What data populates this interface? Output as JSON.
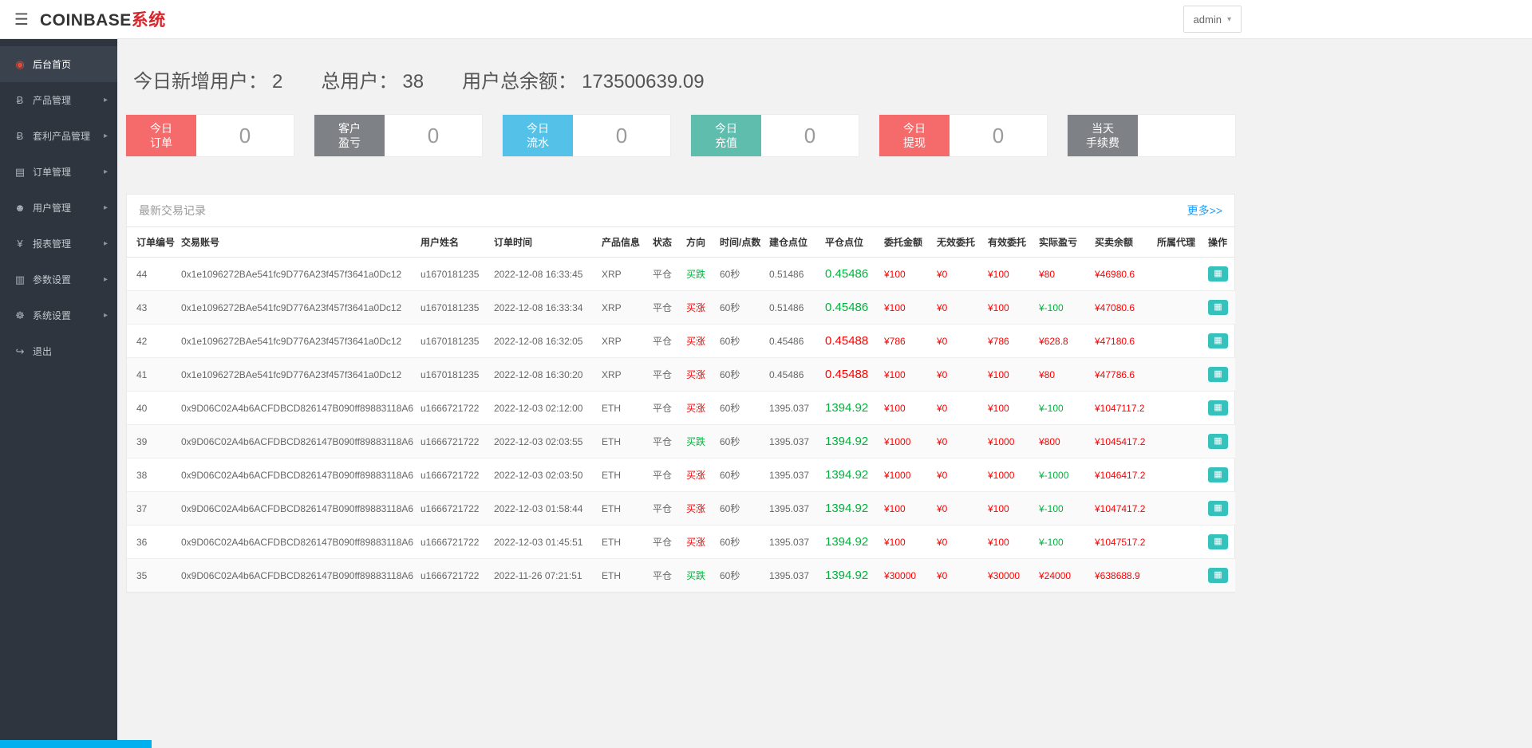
{
  "icons": {
    "menu": "☰",
    "caret_down": "▾",
    "chevron_right": "▸",
    "table_glyph": "▦"
  },
  "colors": {
    "accent_red": "#f56a6a",
    "gray": "#7e8287",
    "blue": "#54c2e8",
    "teal": "#5fbdae",
    "text_red": "#ff0000",
    "text_green": "#00b33c",
    "op_button": "#35c2bd",
    "sidebar_bg": "#2f353e",
    "link_blue": "#1e9fff",
    "scrollbar_thumb": "#00b0ef"
  },
  "topbar": {
    "brand_main": "COINBASE",
    "brand_accent": "系统",
    "user_menu_label": "admin"
  },
  "sidebar": {
    "items": [
      {
        "id": "dashboard",
        "label": "后台首页",
        "glyph": "◉",
        "icon": "dashboard",
        "active": true,
        "expandable": false
      },
      {
        "id": "products",
        "label": "产品管理",
        "glyph": "Ƀ",
        "icon": "bitcoin",
        "active": false,
        "expandable": true
      },
      {
        "id": "arbitrage-products",
        "label": "套利产品管理",
        "glyph": "Ƀ",
        "icon": "bitcoin",
        "active": false,
        "expandable": true
      },
      {
        "id": "orders",
        "label": "订单管理",
        "glyph": "▤",
        "icon": "document",
        "active": false,
        "expandable": true
      },
      {
        "id": "users",
        "label": "用户管理",
        "glyph": "☻",
        "icon": "user",
        "active": false,
        "expandable": true
      },
      {
        "id": "reports",
        "label": "报表管理",
        "glyph": "¥",
        "icon": "yen",
        "active": false,
        "expandable": true
      },
      {
        "id": "parameters",
        "label": "参数设置",
        "glyph": "▥",
        "icon": "document",
        "active": false,
        "expandable": true
      },
      {
        "id": "system",
        "label": "系统设置",
        "glyph": "☸",
        "icon": "gears",
        "active": false,
        "expandable": true
      },
      {
        "id": "logout",
        "label": "退出",
        "glyph": "↪",
        "icon": "logout",
        "active": false,
        "expandable": false
      }
    ]
  },
  "stats_summary": [
    {
      "label": "今日新增用户：",
      "value": "2"
    },
    {
      "label": "总用户：",
      "value": "38"
    },
    {
      "label": "用户总余额：",
      "value": "173500639.09"
    }
  ],
  "stat_cards": [
    {
      "id": "today-orders",
      "line1": "今日",
      "line2": "订单",
      "value": "0",
      "color": "#f56a6a"
    },
    {
      "id": "customer-pnl",
      "line1": "客户",
      "line2": "盈亏",
      "value": "0",
      "color": "#7e8287"
    },
    {
      "id": "today-flow",
      "line1": "今日",
      "line2": "流水",
      "value": "0",
      "color": "#54c2e8"
    },
    {
      "id": "today-deposit",
      "line1": "今日",
      "line2": "充值",
      "value": "0",
      "color": "#5fbdae"
    },
    {
      "id": "today-withdraw",
      "line1": "今日",
      "line2": "提现",
      "value": "0",
      "color": "#f56a6a"
    },
    {
      "id": "today-fees",
      "line1": "当天",
      "line2": "手续费",
      "value": "",
      "color": "#7e8287"
    }
  ],
  "panel": {
    "title": "最新交易记录",
    "more_link": "更多>>"
  },
  "table": {
    "headers": [
      "订单编号",
      "交易账号",
      "用户姓名",
      "订单时间",
      "产品信息",
      "状态",
      "方向",
      "时间/点数",
      "建仓点位",
      "平仓点位",
      "委托金额",
      "无效委托",
      "有效委托",
      "实际盈亏",
      "买卖余额",
      "所属代理",
      "操作"
    ],
    "rows": [
      {
        "id": "44",
        "account": "0x1e1096272BAe541fc9D776A23f457f3641a0Dc12",
        "username": "u1670181235",
        "time": "2022-12-08 16:33:45",
        "product": "XRP",
        "status": "平仓",
        "direction": "买跌",
        "direction_color": "green",
        "duration": "60秒",
        "open_price": "0.51486",
        "close_price": "0.45486",
        "close_color": "green",
        "amount": "¥100",
        "invalid": "¥0",
        "valid": "¥100",
        "profit": "¥80",
        "profit_color": "red",
        "balance": "¥46980.6",
        "agent": ""
      },
      {
        "id": "43",
        "account": "0x1e1096272BAe541fc9D776A23f457f3641a0Dc12",
        "username": "u1670181235",
        "time": "2022-12-08 16:33:34",
        "product": "XRP",
        "status": "平仓",
        "direction": "买涨",
        "direction_color": "red",
        "duration": "60秒",
        "open_price": "0.51486",
        "close_price": "0.45486",
        "close_color": "green",
        "amount": "¥100",
        "invalid": "¥0",
        "valid": "¥100",
        "profit": "¥-100",
        "profit_color": "green",
        "balance": "¥47080.6",
        "agent": ""
      },
      {
        "id": "42",
        "account": "0x1e1096272BAe541fc9D776A23f457f3641a0Dc12",
        "username": "u1670181235",
        "time": "2022-12-08 16:32:05",
        "product": "XRP",
        "status": "平仓",
        "direction": "买涨",
        "direction_color": "red",
        "duration": "60秒",
        "open_price": "0.45486",
        "close_price": "0.45488",
        "close_color": "red",
        "amount": "¥786",
        "invalid": "¥0",
        "valid": "¥786",
        "profit": "¥628.8",
        "profit_color": "red",
        "balance": "¥47180.6",
        "agent": ""
      },
      {
        "id": "41",
        "account": "0x1e1096272BAe541fc9D776A23f457f3641a0Dc12",
        "username": "u1670181235",
        "time": "2022-12-08 16:30:20",
        "product": "XRP",
        "status": "平仓",
        "direction": "买涨",
        "direction_color": "red",
        "duration": "60秒",
        "open_price": "0.45486",
        "close_price": "0.45488",
        "close_color": "red",
        "amount": "¥100",
        "invalid": "¥0",
        "valid": "¥100",
        "profit": "¥80",
        "profit_color": "red",
        "balance": "¥47786.6",
        "agent": ""
      },
      {
        "id": "40",
        "account": "0x9D06C02A4b6ACFDBCD826147B090ff89883118A6",
        "username": "u1666721722",
        "time": "2022-12-03 02:12:00",
        "product": "ETH",
        "status": "平仓",
        "direction": "买涨",
        "direction_color": "red",
        "duration": "60秒",
        "open_price": "1395.037",
        "close_price": "1394.92",
        "close_color": "green",
        "amount": "¥100",
        "invalid": "¥0",
        "valid": "¥100",
        "profit": "¥-100",
        "profit_color": "green",
        "balance": "¥1047117.2",
        "agent": ""
      },
      {
        "id": "39",
        "account": "0x9D06C02A4b6ACFDBCD826147B090ff89883118A6",
        "username": "u1666721722",
        "time": "2022-12-03 02:03:55",
        "product": "ETH",
        "status": "平仓",
        "direction": "买跌",
        "direction_color": "green",
        "duration": "60秒",
        "open_price": "1395.037",
        "close_price": "1394.92",
        "close_color": "green",
        "amount": "¥1000",
        "invalid": "¥0",
        "valid": "¥1000",
        "profit": "¥800",
        "profit_color": "red",
        "balance": "¥1045417.2",
        "agent": ""
      },
      {
        "id": "38",
        "account": "0x9D06C02A4b6ACFDBCD826147B090ff89883118A6",
        "username": "u1666721722",
        "time": "2022-12-03 02:03:50",
        "product": "ETH",
        "status": "平仓",
        "direction": "买涨",
        "direction_color": "red",
        "duration": "60秒",
        "open_price": "1395.037",
        "close_price": "1394.92",
        "close_color": "green",
        "amount": "¥1000",
        "invalid": "¥0",
        "valid": "¥1000",
        "profit": "¥-1000",
        "profit_color": "green",
        "balance": "¥1046417.2",
        "agent": ""
      },
      {
        "id": "37",
        "account": "0x9D06C02A4b6ACFDBCD826147B090ff89883118A6",
        "username": "u1666721722",
        "time": "2022-12-03 01:58:44",
        "product": "ETH",
        "status": "平仓",
        "direction": "买涨",
        "direction_color": "red",
        "duration": "60秒",
        "open_price": "1395.037",
        "close_price": "1394.92",
        "close_color": "green",
        "amount": "¥100",
        "invalid": "¥0",
        "valid": "¥100",
        "profit": "¥-100",
        "profit_color": "green",
        "balance": "¥1047417.2",
        "agent": ""
      },
      {
        "id": "36",
        "account": "0x9D06C02A4b6ACFDBCD826147B090ff89883118A6",
        "username": "u1666721722",
        "time": "2022-12-03 01:45:51",
        "product": "ETH",
        "status": "平仓",
        "direction": "买涨",
        "direction_color": "red",
        "duration": "60秒",
        "open_price": "1395.037",
        "close_price": "1394.92",
        "close_color": "green",
        "amount": "¥100",
        "invalid": "¥0",
        "valid": "¥100",
        "profit": "¥-100",
        "profit_color": "green",
        "balance": "¥1047517.2",
        "agent": ""
      },
      {
        "id": "35",
        "account": "0x9D06C02A4b6ACFDBCD826147B090ff89883118A6",
        "username": "u1666721722",
        "time": "2022-11-26 07:21:51",
        "product": "ETH",
        "status": "平仓",
        "direction": "买跌",
        "direction_color": "green",
        "duration": "60秒",
        "open_price": "1395.037",
        "close_price": "1394.92",
        "close_color": "green",
        "amount": "¥30000",
        "invalid": "¥0",
        "valid": "¥30000",
        "profit": "¥24000",
        "profit_color": "red",
        "balance": "¥638688.9",
        "agent": ""
      }
    ]
  }
}
